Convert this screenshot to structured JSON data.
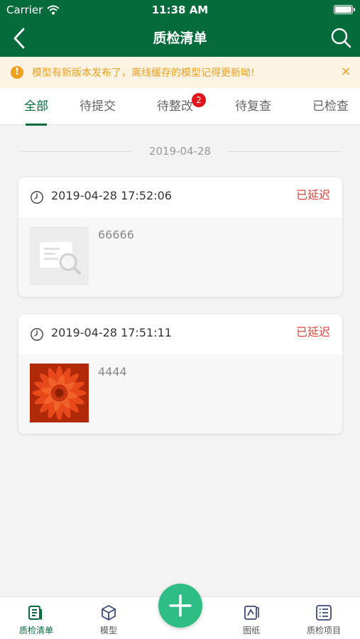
{
  "status_bar": {
    "carrier": "Carrier",
    "time": "11:38 AM"
  },
  "nav": {
    "title": "质检清单"
  },
  "notice": {
    "icon_text": "!",
    "text": "模型有新版本发布了，离线缓存的模型记得更新呦!",
    "close": "×"
  },
  "tabs": [
    {
      "label": "全部",
      "active": true
    },
    {
      "label": "待提交"
    },
    {
      "label": "待整改",
      "badge": "2"
    },
    {
      "label": "待复查"
    },
    {
      "label": "已检查"
    }
  ],
  "list": {
    "date": "2019-04-28",
    "items": [
      {
        "time": "2019-04-28 17:52:06",
        "status": "已延迟",
        "description": "66666",
        "thumbnail": "document-search-placeholder"
      },
      {
        "time": "2019-04-28 17:51:11",
        "status": "已延迟",
        "description": "4444",
        "thumbnail": "orange-flower-photo"
      }
    ]
  },
  "tabbar": {
    "items": [
      {
        "label": "质检清单",
        "icon": "checklist-icon",
        "active": true
      },
      {
        "label": "模型",
        "icon": "cube-icon"
      },
      {
        "label": "图纸",
        "icon": "drawing-icon"
      },
      {
        "label": "质检项目",
        "icon": "list-icon"
      }
    ],
    "fab_icon": "plus-icon"
  },
  "colors": {
    "primary": "#056b3b",
    "accent": "#2ebd84",
    "warning": "#f0a020",
    "delayed": "#e1443c",
    "badge": "#e3141b"
  }
}
